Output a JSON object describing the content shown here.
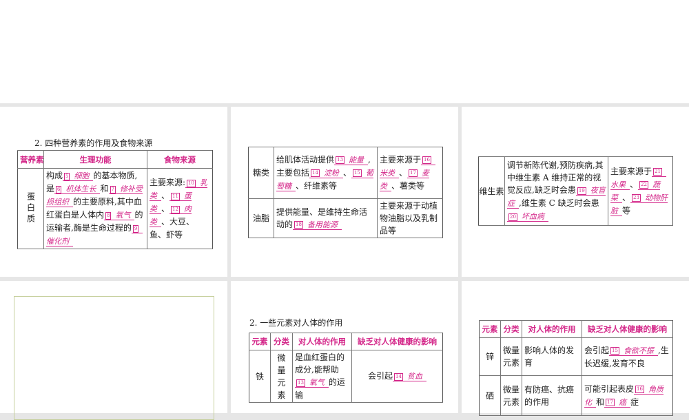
{
  "slides": [
    {
      "title": "2. 四种营养素的作用及食物来源",
      "headers": [
        "营养素",
        "生理功能",
        "食物来源"
      ],
      "rows": [
        {
          "name": "蛋白质",
          "func": [
            {
              "t": "构成"
            },
            {
              "n": "5",
              "a": "细胞"
            },
            {
              "t": "的基本物质,是"
            },
            {
              "n": "6",
              "a": "机体生长"
            },
            {
              "t": "和"
            },
            {
              "n": "7",
              "a": "修补受损组织"
            },
            {
              "t": "的主要原料,其中血红蛋白是人体内"
            },
            {
              "n": "8",
              "a": "氧气"
            },
            {
              "t": "的运输者,酶是生命过程的"
            },
            {
              "n": "9",
              "a": "催化剂"
            }
          ],
          "src": [
            {
              "t": "主要来源:"
            },
            {
              "n": "10",
              "a": "乳类"
            },
            {
              "t": "、"
            },
            {
              "n": "11",
              "a": "蛋类"
            },
            {
              "t": "、"
            },
            {
              "n": "12",
              "a": "肉类"
            },
            {
              "t": "、大豆、鱼、虾等"
            }
          ]
        }
      ]
    },
    {
      "rows": [
        {
          "name": "糖类",
          "func": [
            {
              "t": "给肌体活动提供"
            },
            {
              "n": "13",
              "a": "能量"
            },
            {
              "t": ",主要包括"
            },
            {
              "n": "14",
              "a": "淀粉"
            },
            {
              "t": "、"
            },
            {
              "n": "15",
              "a": "葡萄糖"
            },
            {
              "t": "、纤维素等"
            }
          ],
          "src": [
            {
              "t": "主要来源于"
            },
            {
              "n": "16",
              "a": "米类"
            },
            {
              "t": "、"
            },
            {
              "n": "17",
              "a": "麦类"
            },
            {
              "t": "、薯类等"
            }
          ]
        },
        {
          "name": "油脂",
          "func": [
            {
              "t": "提供能量、是维持生命活动的"
            },
            {
              "n": "18",
              "a": "备用能源"
            }
          ],
          "src": [
            {
              "t": "主要来源于动植物油脂以及乳制品等"
            }
          ]
        }
      ]
    },
    {
      "rows": [
        {
          "name": "维生素",
          "func": [
            {
              "t": "调节新陈代谢,预防疾病,其中维生素 A 维持正常的视觉反应,缺乏时会患"
            },
            {
              "n": "19",
              "a": "夜盲症"
            },
            {
              "t": ",维生素 C 缺乏时会患"
            },
            {
              "n": "20",
              "a": "坏血病"
            }
          ],
          "src": [
            {
              "t": "主要来源于"
            },
            {
              "n": "21",
              "a": "水果"
            },
            {
              "t": "、"
            },
            {
              "n": "22",
              "a": "蔬菜"
            },
            {
              "t": "、"
            },
            {
              "n": "23",
              "a": "动物肝脏"
            },
            {
              "t": "等"
            }
          ]
        }
      ]
    },
    {},
    {
      "title": "2. 一些元素对人体的作用",
      "headers": [
        "元素",
        "分类",
        "对人体的作用",
        "缺乏对人体健康的影响"
      ],
      "rows": [
        {
          "name": "铁",
          "cat": "微量元素",
          "func": [
            {
              "t": "是血红蛋白的成分,能帮助"
            },
            {
              "n": "13",
              "a": "氧气"
            },
            {
              "t": "的运输"
            }
          ],
          "src": [
            {
              "t": "会引起"
            },
            {
              "n": "14",
              "a": "贫血"
            }
          ]
        }
      ]
    },
    {
      "headers": [
        "元素",
        "分类",
        "对人体的作用",
        "缺乏对人体健康的影响"
      ],
      "rows": [
        {
          "name": "锌",
          "cat": "微量元素",
          "func": [
            {
              "t": "影响人体的发育"
            }
          ],
          "src": [
            {
              "t": "会引起"
            },
            {
              "n": "15",
              "a": "食欲不振"
            },
            {
              "t": ",生长迟缓,发育不良"
            }
          ]
        },
        {
          "name": "硒",
          "cat": "微量元素",
          "func": [
            {
              "t": "有防癌、抗癌的作用"
            }
          ],
          "src": [
            {
              "t": "可能引起表皮"
            },
            {
              "n": "16",
              "a": "角质化"
            },
            {
              "t": "和"
            },
            {
              "n": "17",
              "a": "癌"
            },
            {
              "t": "症"
            }
          ]
        }
      ]
    }
  ]
}
